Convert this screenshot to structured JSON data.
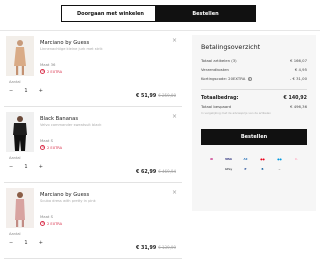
{
  "top": {
    "continue_label": "Doorgaan met winkelen",
    "order_label": "Bestellen"
  },
  "items": [
    {
      "brand": "Marciano by Guess",
      "desc": "Linnenachtige kleine jurk met strik",
      "size": "Maat 36",
      "promo": "2 EXTRA",
      "qty_label": "Aantal",
      "qty": "1",
      "price": "€ 51,99",
      "old_price": "€ 259,00"
    },
    {
      "brand": "Black Bananas",
      "desc": "Velvo commander sweatsuit black",
      "size": "Maat S",
      "promo": "2 EXTRA",
      "qty_label": "Aantal",
      "qty": "1",
      "price": "€ 62,99",
      "old_price": "€ 469,94"
    },
    {
      "brand": "Marciano by Guess",
      "desc": "Scuba dress with pretty in pink",
      "size": "Maat S",
      "promo": "2 EXTRA",
      "qty_label": "Aantal",
      "qty": "1",
      "price": "€ 31,99",
      "old_price": "€ 139,99"
    }
  ],
  "summary": {
    "title": "Betalingsoverzicht",
    "rows": [
      {
        "label": "Totaal artikelen (3)",
        "value": "€ 166,07"
      },
      {
        "label": "Verzendkosten",
        "value": "€ 4,95"
      },
      {
        "label": "Kortingscode: 20EXTRA",
        "value": "- € 31,00"
      }
    ],
    "total_label": "Totaalbedrag:",
    "total_value": "€ 140,92",
    "saved_label": "Totaal bespaard",
    "saved_value": "€ 496,36",
    "note": "In vergelijking met de adviesprijs van de artikelen",
    "order_label": "Bestellen"
  },
  "payments": [
    {
      "name": "ideal-icon",
      "label": "iD",
      "color": "#c4217f"
    },
    {
      "name": "visa-icon",
      "label": "VISA",
      "color": "#1a1f71"
    },
    {
      "name": "amex-icon",
      "label": "AX",
      "color": "#2e77bc"
    },
    {
      "name": "mastercard-icon",
      "label": "●●",
      "color": "#eb001b"
    },
    {
      "name": "maestro-icon",
      "label": "●●",
      "color": "#0099df"
    },
    {
      "name": "klarna-icon",
      "label": "K.",
      "color": "#ffb3c7"
    },
    {
      "name": "gpay-icon",
      "label": "GPay",
      "color": "#5f6368"
    },
    {
      "name": "paypal-icon",
      "label": "P",
      "color": "#003087"
    },
    {
      "name": "bancontact-icon",
      "label": "B",
      "color": "#005498"
    },
    {
      "name": "afterpay-icon",
      "label": "~",
      "color": "#444444"
    }
  ]
}
